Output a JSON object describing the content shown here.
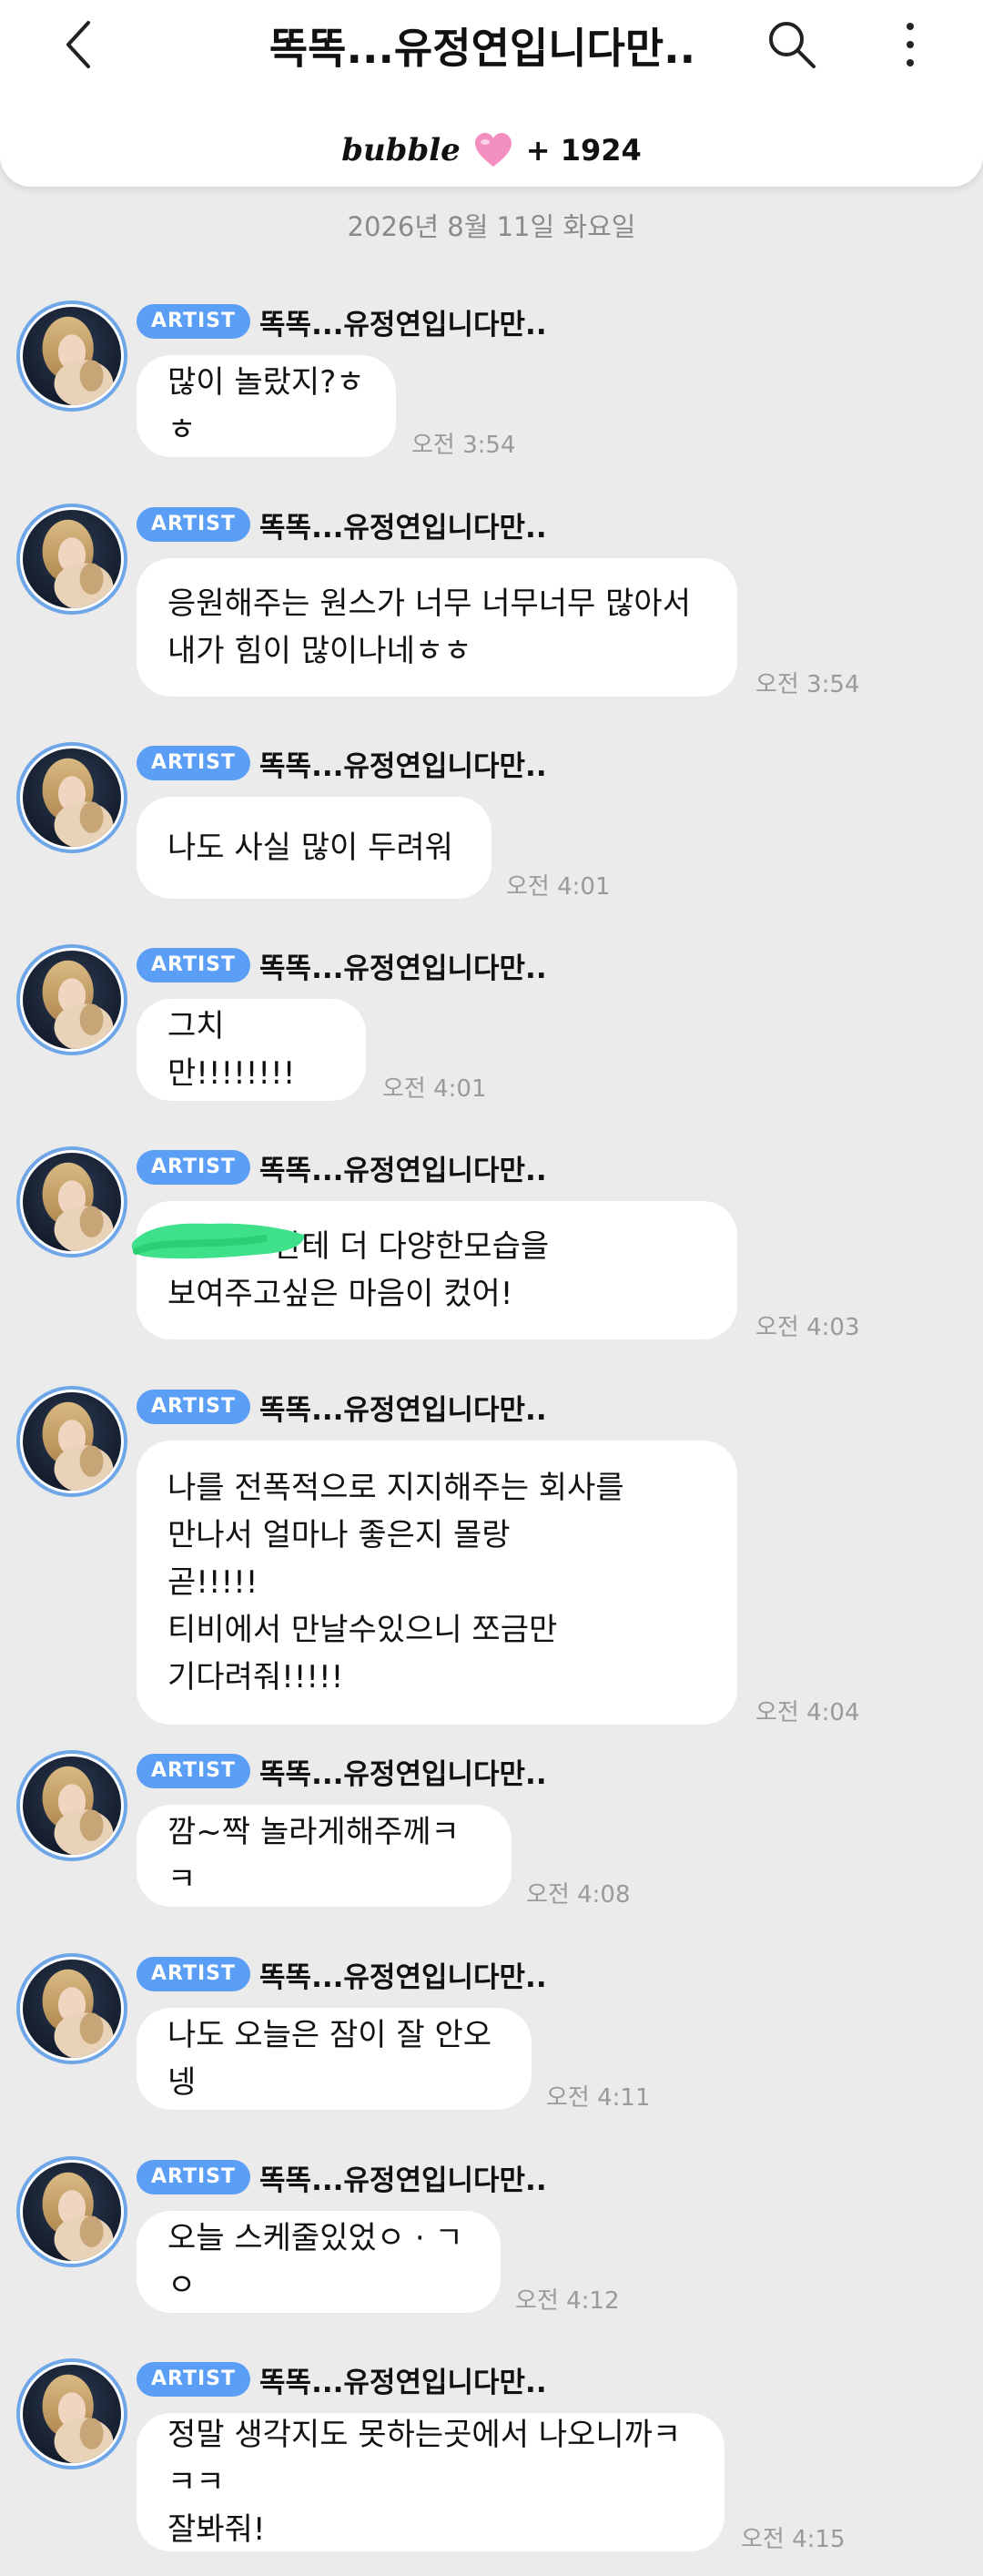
{
  "header": {
    "title": "똑똑...유정연입니다만..",
    "brand": "bubble",
    "count": "+ 1924",
    "heart_color": "#f28fc0"
  },
  "date_separator": "2026년 8월 11일 화요일",
  "badge_label": "ARTIST",
  "sender": "똑똑...유정연입니다만..",
  "messages": [
    {
      "text": "많이 놀랐지?ㅎㅎ",
      "time": "오전 3:54"
    },
    {
      "text": "응원해주는 원스가 너무 너무너무 많아서\n내가 힘이 많이나네ㅎㅎ",
      "time": "오전 3:54"
    },
    {
      "text": "나도 사실 많이 두려워",
      "time": "오전 4:01"
    },
    {
      "text": "그치만!!!!!!!!",
      "time": "오전 4:01"
    },
    {
      "text": "한테 더 다양한모습을\n보여주고싶은 마음이 컸어!",
      "time": "오전 4:03"
    },
    {
      "text": "나를 전폭적으로 지지해주는 회사를\n만나서 얼마나 좋은지 몰랑\n곧!!!!!\n티비에서 만날수있으니 쪼금만\n기다려줘!!!!!",
      "time": "오전 4:04"
    },
    {
      "text": "깜~짝 놀라게해주께ㅋㅋ",
      "time": "오전 4:08"
    },
    {
      "text": "나도 오늘은 잠이 잘 안오넹",
      "time": "오전 4:11"
    },
    {
      "text": "오늘 스케줄있었ㅇ · ㄱㅇ",
      "time": "오전 4:12"
    },
    {
      "text": "정말 생각지도 못하는곳에서 나오니까ㅋㅋㅋ\n잘봐줘!",
      "time": "오전 4:15"
    }
  ]
}
